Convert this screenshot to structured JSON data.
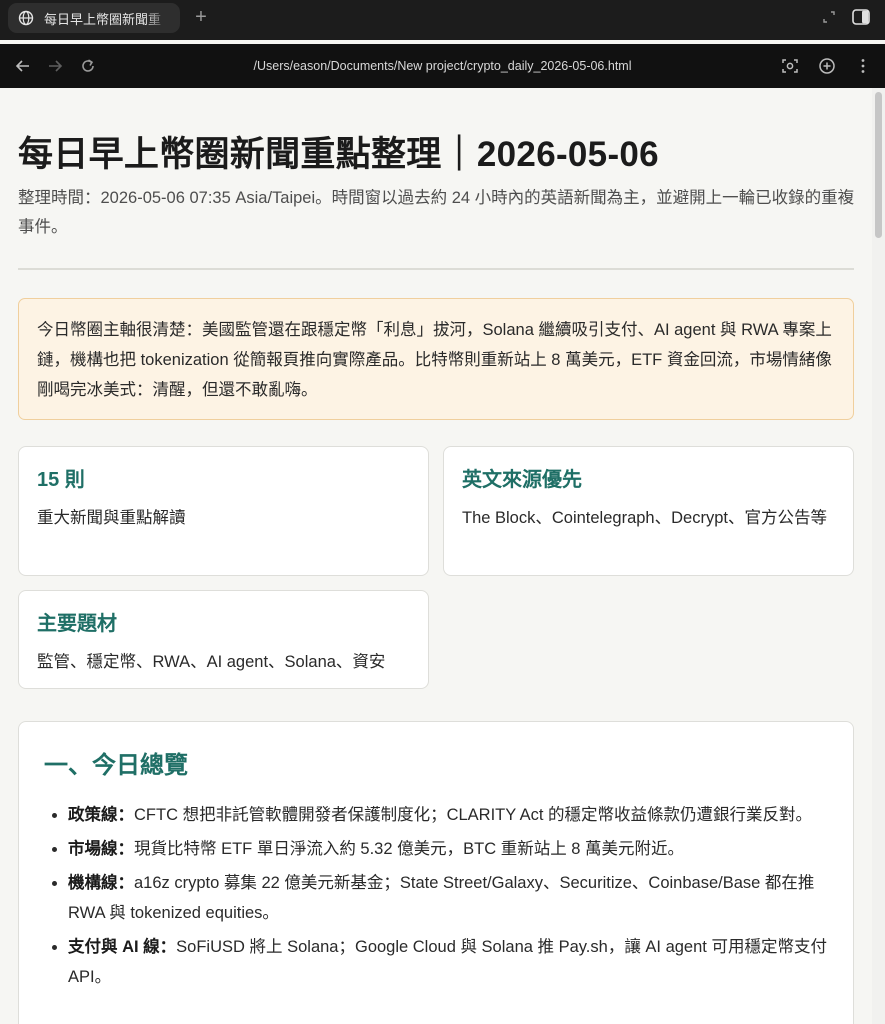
{
  "browser": {
    "tab_title": "每日早上幣圈新聞重",
    "url": "/Users/eason/Documents/New project/crypto_daily_2026-05-06.html",
    "new_tab_symbol": "+"
  },
  "page": {
    "title": "每日早上幣圈新聞重點整理｜2026-05-06",
    "meta": "整理時間：2026-05-06 07:35 Asia/Taipei。時間窗以過去約 24 小時內的英語新聞為主，並避開上一輪已收錄的重複事件。",
    "summary": "今日幣圈主軸很清楚：美國監管還在跟穩定幣「利息」拔河，Solana 繼續吸引支付、AI agent 與 RWA 專案上鏈，機構也把 tokenization 從簡報頁推向實際產品。比特幣則重新站上 8 萬美元，ETF 資金回流，市場情緒像剛喝完冰美式：清醒，但還不敢亂嗨。",
    "cards": [
      {
        "title": "15 則",
        "text": "重大新聞與重點解讀"
      },
      {
        "title": "英文來源優先",
        "text": "The Block、Cointelegraph、Decrypt、官方公告等"
      },
      {
        "title": "主要題材",
        "text": "監管、穩定幣、RWA、AI agent、Solana、資安"
      }
    ],
    "overview": {
      "heading": "一、今日總覽",
      "items": [
        {
          "label": "政策線：",
          "text": "CFTC 想把非託管軟體開發者保護制度化；CLARITY Act 的穩定幣收益條款仍遭銀行業反對。"
        },
        {
          "label": "市場線：",
          "text": "現貨比特幣 ETF 單日淨流入約 5.32 億美元，BTC 重新站上 8 萬美元附近。"
        },
        {
          "label": "機構線：",
          "text": "a16z crypto 募集 22 億美元新基金；State Street/Galaxy、Securitize、Coinbase/Base 都在推 RWA 與 tokenized equities。"
        },
        {
          "label": "支付與 AI 線：",
          "text": "SoFiUSD 將上 Solana；Google Cloud 與 Solana 推 Pay.sh，讓 AI agent 可用穩定幣支付 API。"
        }
      ]
    }
  }
}
